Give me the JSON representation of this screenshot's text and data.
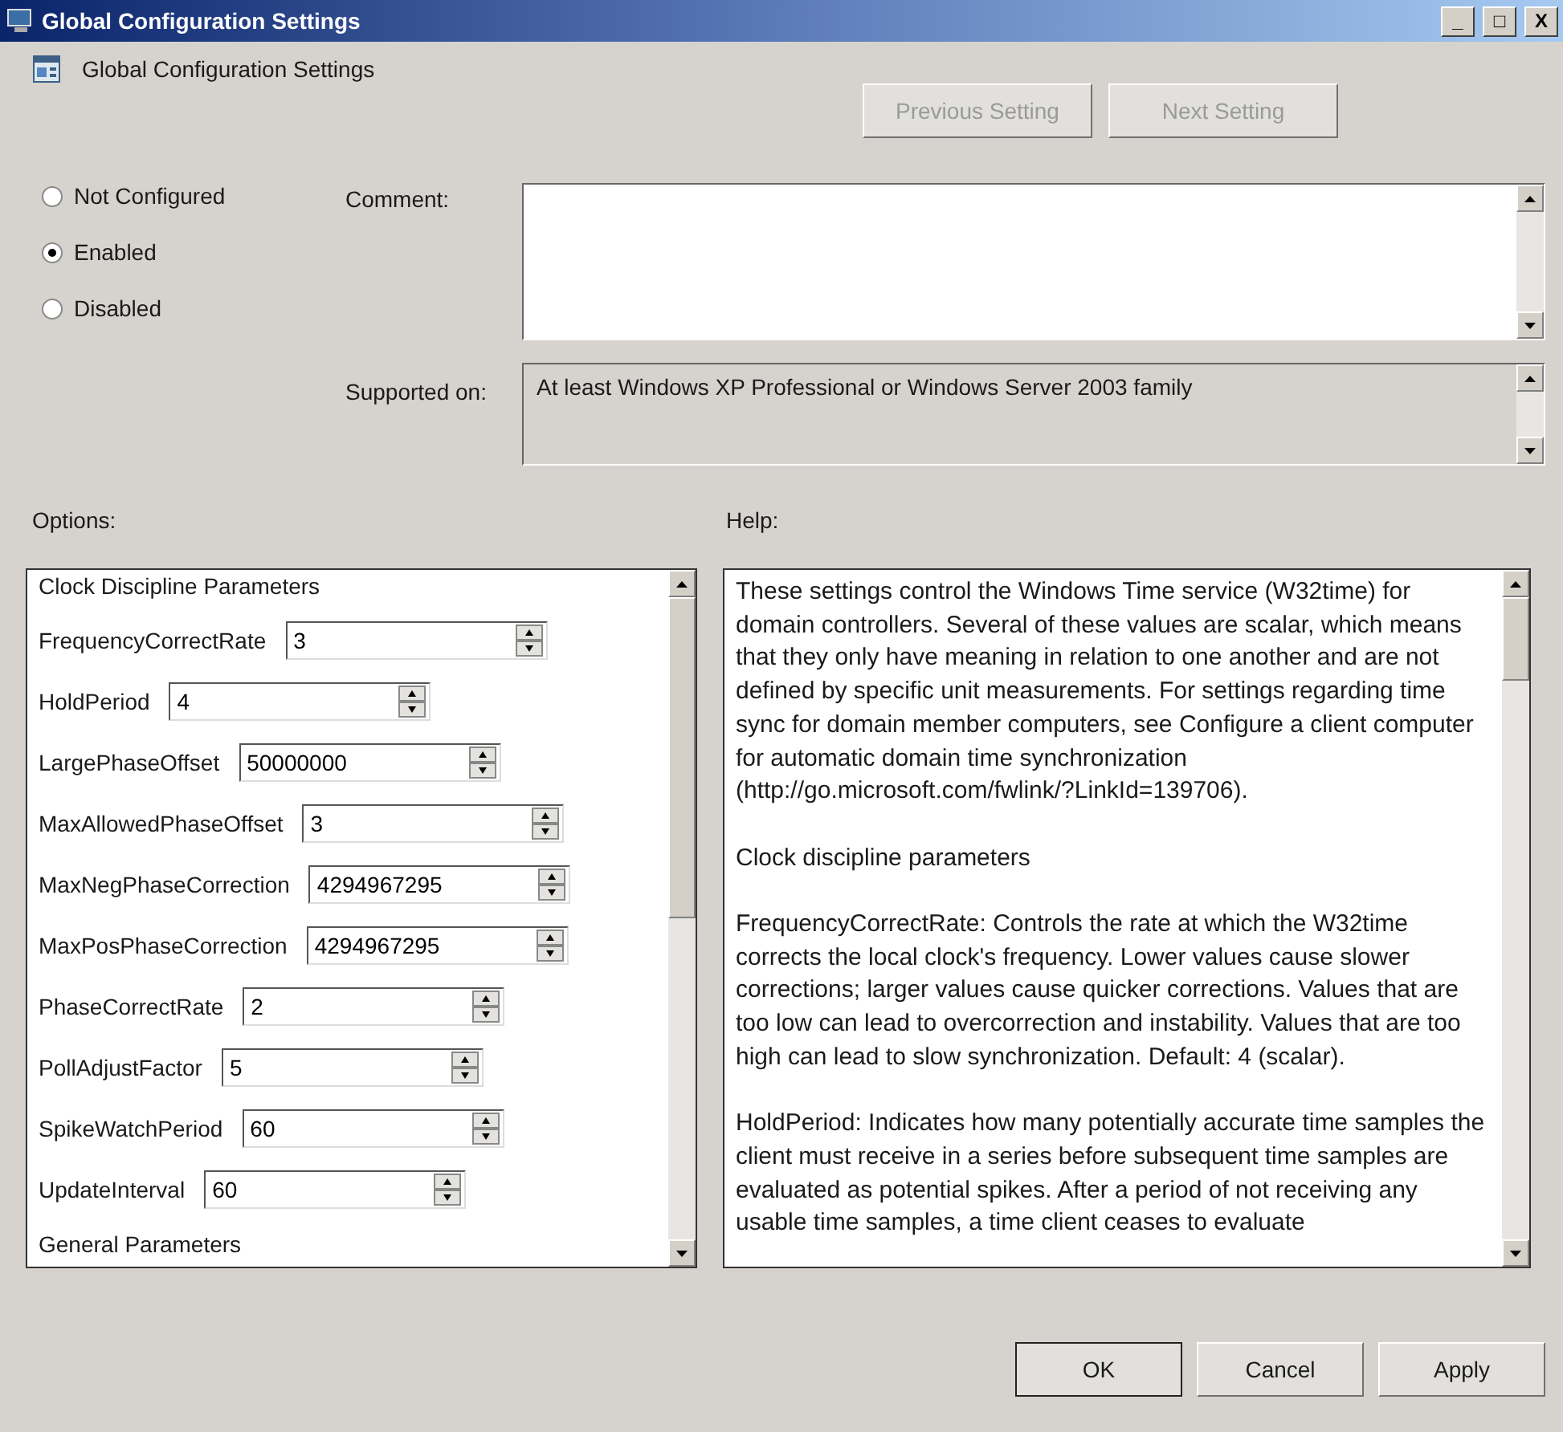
{
  "window": {
    "title": "Global Configuration Settings",
    "controls": [
      "_",
      "□",
      "X"
    ]
  },
  "header": {
    "title": "Global Configuration Settings"
  },
  "nav_buttons": [
    {
      "label": "Previous Setting",
      "disabled": true
    },
    {
      "label": "Next Setting",
      "disabled": true
    }
  ],
  "state_options": [
    {
      "label": "Not Configured",
      "selected": false
    },
    {
      "label": "Enabled",
      "selected": true
    },
    {
      "label": "Disabled",
      "selected": false
    }
  ],
  "comment": {
    "label": "Comment:"
  },
  "supported_on": {
    "label": "Supported on:",
    "value": "At least Windows XP Professional or Windows Server 2003 family"
  },
  "options": {
    "label": "Options:",
    "items": [
      {
        "kind": "heading",
        "label": "Clock Discipline Parameters"
      },
      {
        "kind": "spin",
        "label": "FrequencyCorrectRate",
        "value": "3"
      },
      {
        "kind": "spin",
        "label": "HoldPeriod",
        "value": "4"
      },
      {
        "kind": "spin",
        "label": "LargePhaseOffset",
        "value": "50000000"
      },
      {
        "kind": "spin",
        "label": "MaxAllowedPhaseOffset",
        "value": "3"
      },
      {
        "kind": "spin",
        "label": "MaxNegPhaseCorrection",
        "value": "4294967295"
      },
      {
        "kind": "spin",
        "label": "MaxPosPhaseCorrection",
        "value": "4294967295"
      },
      {
        "kind": "spin",
        "label": "PhaseCorrectRate",
        "value": "2"
      },
      {
        "kind": "spin",
        "label": "PollAdjustFactor",
        "value": "5"
      },
      {
        "kind": "spin",
        "label": "SpikeWatchPeriod",
        "value": "60"
      },
      {
        "kind": "spin",
        "label": "UpdateInterval",
        "value": "60"
      },
      {
        "kind": "heading",
        "label": "General Parameters"
      }
    ]
  },
  "help": {
    "label": "Help:",
    "paragraphs": [
      "These settings control the Windows Time service (W32time) for domain controllers. Several of these values are scalar, which means that they only have meaning in relation to one another and are not defined by specific unit measurements. For settings regarding time sync for domain member computers, see Configure a client computer for automatic domain time synchronization (http://go.microsoft.com/fwlink/?LinkId=139706).",
      "Clock discipline parameters",
      "FrequencyCorrectRate: Controls the rate at which the W32time corrects the local clock's frequency. Lower values cause slower corrections; larger values cause quicker corrections. Values that are too low can lead to overcorrection and instability. Values that are too high can lead to slow synchronization. Default: 4 (scalar).",
      "HoldPeriod: Indicates how many potentially accurate time samples the client must receive in a series before subsequent time samples are evaluated as potential spikes. After a period of not receiving any usable time samples, a time client ceases to evaluate"
    ]
  },
  "footer_buttons": [
    {
      "label": "OK",
      "default": true
    },
    {
      "label": "Cancel",
      "default": false
    },
    {
      "label": "Apply",
      "default": false
    }
  ]
}
